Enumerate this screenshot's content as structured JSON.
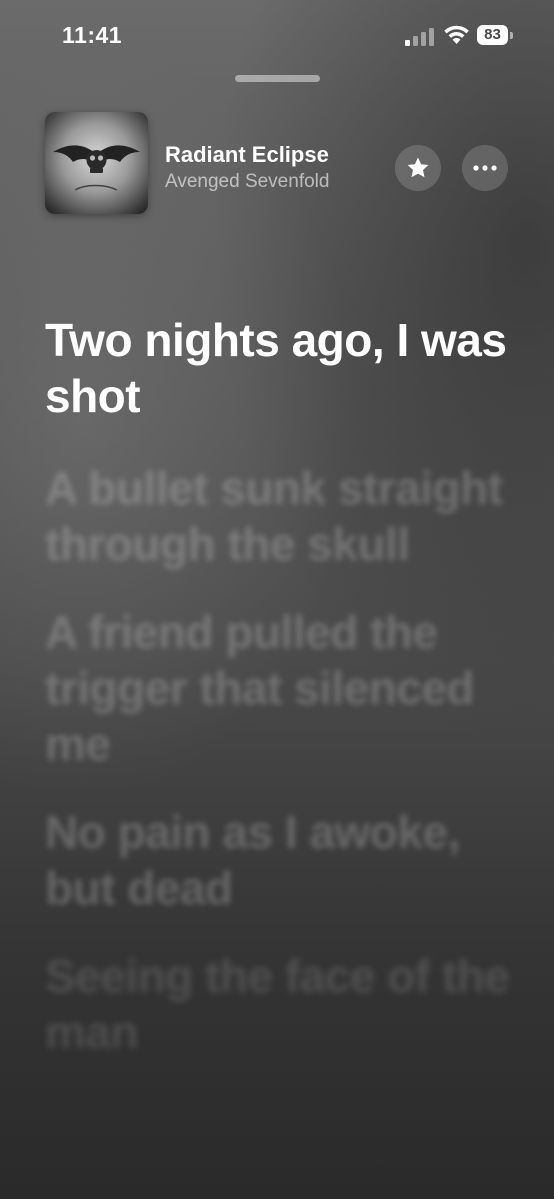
{
  "status_bar": {
    "time": "11:41",
    "battery_level": "83"
  },
  "now_playing": {
    "title": "Radiant Eclipse",
    "artist": "Avenged Sevenfold",
    "artwork_icon": "album-artwork-winged-skull"
  },
  "lyrics": [
    "Two nights ago, I was shot",
    "A bullet sunk straight through the skull",
    "A friend pulled the trigger that silenced me",
    "No pain as I awoke, but dead",
    "Seeing the face of the man"
  ],
  "colors": {
    "background_top": "#6b6b6b",
    "background_bottom": "#2a2a2a",
    "text": "#ffffff"
  }
}
